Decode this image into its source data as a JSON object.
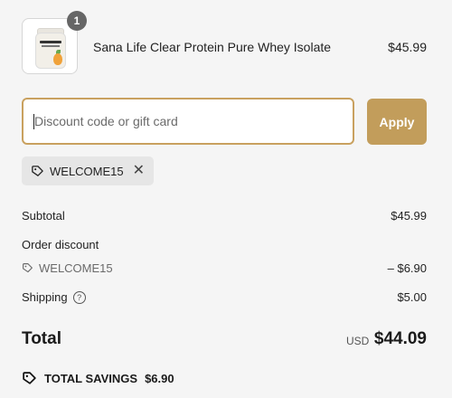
{
  "product": {
    "name": "Sana Life Clear Protein Pure Whey Isolate",
    "price": "$45.99",
    "quantity": "1",
    "image_icon": "protein-jar-image"
  },
  "discount": {
    "placeholder": "Discount code or gift card",
    "apply_label": "Apply",
    "applied_code": "WELCOME15"
  },
  "summary": {
    "subtotal_label": "Subtotal",
    "subtotal_value": "$45.99",
    "order_discount_label": "Order discount",
    "discount_code": "WELCOME15",
    "discount_value": "– $6.90",
    "shipping_label": "Shipping",
    "shipping_value": "$5.00",
    "total_label": "Total",
    "currency": "USD",
    "total_value": "$44.09",
    "savings_label": "TOTAL SAVINGS",
    "savings_value": "$6.90"
  },
  "colors": {
    "accent": "#c29d5b",
    "background": "#f5f5f5"
  }
}
